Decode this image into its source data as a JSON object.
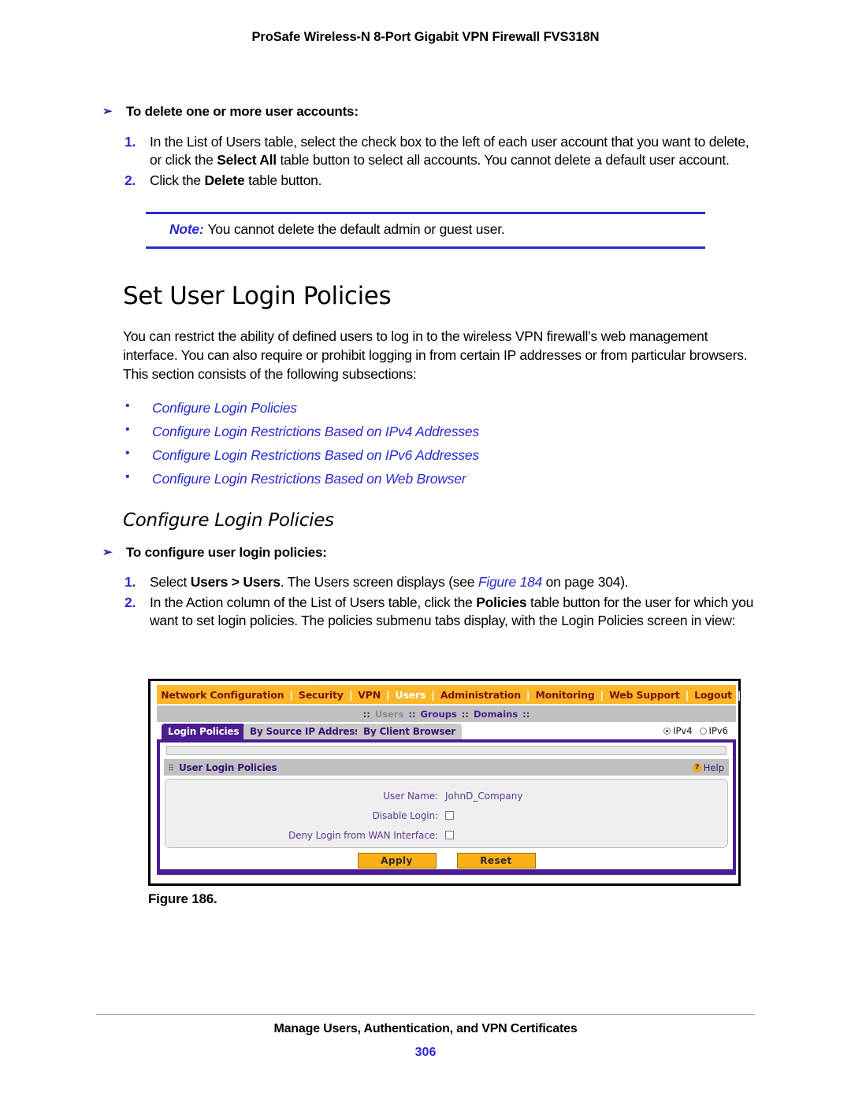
{
  "running_header": "ProSafe Wireless-N 8-Port Gigabit VPN Firewall FVS318N",
  "procedure_delete": {
    "heading": "To delete one or more user accounts:",
    "arrow_glyph": "➢",
    "steps": [
      {
        "number": "1.",
        "parts": [
          {
            "text": "In the List of Users table, select the check box to the left of each user account that you want to delete, or click the ",
            "bold": false
          },
          {
            "text": "Select All",
            "bold": true
          },
          {
            "text": " table button to select all accounts. You cannot delete a default user account.",
            "bold": false
          }
        ]
      },
      {
        "number": "2.",
        "parts": [
          {
            "text": "Click the ",
            "bold": false
          },
          {
            "text": "Delete",
            "bold": true
          },
          {
            "text": " table button.",
            "bold": false
          }
        ]
      }
    ]
  },
  "note": {
    "label": "Note:",
    "text": "You cannot delete the default admin or guest user."
  },
  "section": {
    "title": "Set User Login Policies",
    "paragraph": "You can restrict the ability of defined users to log in to the wireless VPN firewall’s web management interface. You can also require or prohibit logging in from certain IP addresses or from particular browsers. This section consists of the following subsections:",
    "bullet_glyph": "•",
    "links": [
      "Configure Login Policies",
      "Configure Login Restrictions Based on IPv4 Addresses",
      "Configure Login Restrictions Based on IPv6 Addresses",
      "Configure Login Restrictions Based on Web Browser"
    ]
  },
  "subsection": {
    "title": "Configure Login Policies",
    "procedure_heading": "To configure user login policies:",
    "arrow_glyph": "➢",
    "steps": [
      {
        "number": "1.",
        "parts": [
          {
            "text": "Select ",
            "bold": false
          },
          {
            "text": "Users > Users",
            "bold": true
          },
          {
            "text": ". The Users screen displays (see ",
            "bold": false
          },
          {
            "text": "Figure 184",
            "link": true
          },
          {
            "text": " on page 304).",
            "bold": false
          }
        ]
      },
      {
        "number": "2.",
        "parts": [
          {
            "text": "In the Action column of the List of Users table, click the ",
            "bold": false
          },
          {
            "text": "Policies",
            "bold": true
          },
          {
            "text": " table button for the user for which you want to set login policies. The policies submenu tabs display, with the Login Policies screen in view:",
            "bold": false
          }
        ]
      }
    ]
  },
  "screenshot": {
    "main_nav": {
      "separator": "|",
      "items": [
        {
          "label": "Network Configuration",
          "active": false
        },
        {
          "label": "Security",
          "active": false
        },
        {
          "label": "VPN",
          "active": false
        },
        {
          "label": "Users",
          "active": true
        },
        {
          "label": "Administration",
          "active": false
        },
        {
          "label": "Monitoring",
          "active": false
        },
        {
          "label": "Web Support",
          "active": false
        },
        {
          "label": "Logout",
          "active": false
        }
      ]
    },
    "sub_nav": {
      "separator": "::",
      "items": [
        {
          "label": "Users",
          "current": true
        },
        {
          "label": "Groups",
          "current": false
        },
        {
          "label": "Domains",
          "current": false
        }
      ]
    },
    "tabs": [
      {
        "label": "Login Policies",
        "active": true
      },
      {
        "label": "By Source IP Address",
        "active": false
      },
      {
        "label": "By Client Browser",
        "active": false
      }
    ],
    "ip_version": {
      "ipv4_label": "IPv4",
      "ipv6_label": "IPv6",
      "selected": "IPv4"
    },
    "panel": {
      "title": "User Login Policies",
      "help_label": "Help",
      "help_icon_glyph": "?",
      "rows": [
        {
          "label": "User Name:",
          "value": "JohnD_Company",
          "type": "text"
        },
        {
          "label": "Disable Login:",
          "value": "",
          "type": "checkbox",
          "checked": false
        },
        {
          "label": "Deny Login from WAN Interface:",
          "value": "",
          "type": "checkbox",
          "checked": false
        }
      ]
    },
    "buttons": [
      {
        "label": "Apply"
      },
      {
        "label": "Reset"
      }
    ]
  },
  "figure_caption": "Figure 186.",
  "footer": {
    "title": "Manage Users, Authentication, and VPN Certificates",
    "page_number": "306"
  },
  "colors": {
    "link_blue": "#2a2ad0",
    "nav_orange": "#fbb016",
    "nav_text": "#7a1212",
    "panel_purple": "#4c1d91",
    "form_label": "#5b3a8e"
  }
}
